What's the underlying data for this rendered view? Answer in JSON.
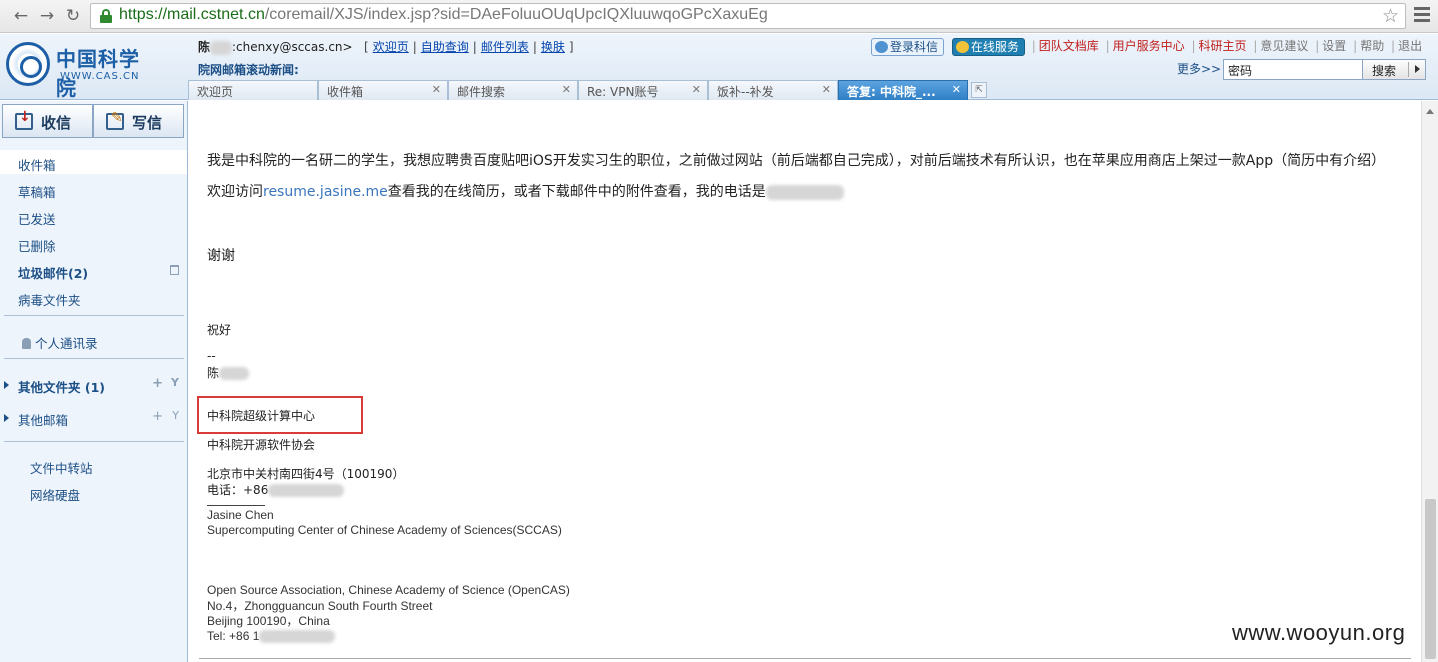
{
  "browser": {
    "url_host": "https://mail.cstnet.cn",
    "url_rest": "/coremail/XJS/index.jsp?sid=DAeFoluuOUqUpcIQXluuwqoGPcXaxuEg"
  },
  "header": {
    "logo_cn": "中国科学院",
    "logo_en": "WWW.CAS.CN",
    "user_name": "陈",
    "user_email": ":chenxy@sccas.cn>",
    "links": [
      "欢迎页",
      "自助查询",
      "邮件列表",
      "换肤"
    ],
    "news_label": "院网邮箱滚动新闻:",
    "login_pill": "登录科信",
    "service_pill": "在线服务",
    "red_links": [
      "团队文档库",
      "用户服务中心",
      "科研主页"
    ],
    "gray_links": [
      "意见建议",
      "设置",
      "帮助",
      "退出"
    ],
    "more": "更多>>",
    "search_value": "密码",
    "search_button": "搜索"
  },
  "tabs": [
    {
      "label": "欢迎页"
    },
    {
      "label": "收件箱"
    },
    {
      "label": "邮件搜索"
    },
    {
      "label": "Re: VPN账号"
    },
    {
      "label": "饭补--补发"
    },
    {
      "label": "答复: 中科院_..."
    }
  ],
  "sidebar": {
    "receive": "收信",
    "compose": "写信",
    "folders": [
      "收件箱",
      "草稿箱",
      "已发送",
      "已删除",
      "垃圾邮件(2)",
      "病毒文件夹"
    ],
    "contacts": "个人通讯录",
    "other_folders": "其他文件夹 (1)",
    "other_mailboxes": "其他邮箱",
    "tools": [
      "文件中转站",
      "网络硬盘"
    ]
  },
  "mail": {
    "para1": "我是中科院的一名研二的学生，我想应聘贵百度贴吧iOS开发实习生的职位，之前做过网站（前后端都自己完成），对前后端技术有所认识，也在苹果应用商店上架过一款App（简历中有介绍）",
    "para2_prefix": "欢迎访问",
    "para2_link": "resume.jasine.me",
    "para2_suffix": "查看我的在线简历，或者下载邮件中的附件查看，我的电话是",
    "thanks": "谢谢",
    "regards": "祝好",
    "dash": "--",
    "sig_name": "陈",
    "org1": "中科院超级计算中心",
    "org2": "中科院开源软件协会",
    "address": "北京市中关村南四街4号（100190）",
    "phone": "电话：+86",
    "en_name": "Jasine Chen",
    "en_org1": "Supercomputing Center of Chinese Academy of Sciences(SCCAS)",
    "en_org2": "Open Source Association, Chinese Academy of Science (OpenCAS)",
    "en_addr1": "No.4，Zhongguancun South Fourth Street",
    "en_addr2": "Beijing  100190，China",
    "en_tel": "Tel:  +86 1"
  },
  "watermark": "www.wooyun.org",
  "colors": {
    "accent": "#2f7fc6",
    "highlight_box": "#d93a3a",
    "link": "#0645ad"
  }
}
